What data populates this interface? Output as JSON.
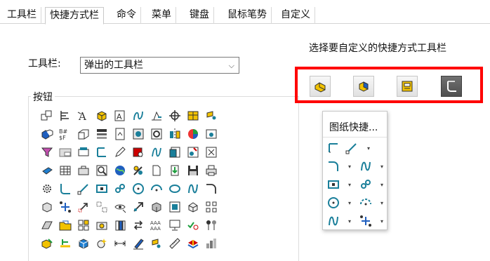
{
  "tabs": [
    "工具栏",
    "快捷方式栏",
    "命令",
    "菜单",
    "键盘",
    "鼠标笔势",
    "自定义"
  ],
  "active_tab": "快捷方式栏",
  "toolbar_label": "工具栏:",
  "toolbar_select_value": "弹出的工具栏",
  "buttons_group_title": "按钮",
  "right_title": "选择要自定义的快捷方式工具栏",
  "popup_title": "图纸快捷...",
  "colors": {
    "selection_highlight": "#ff0000",
    "icon_teal": "#1a7f9a",
    "icon_yellow": "#f2c200",
    "icon_blue": "#1f5fbf"
  }
}
